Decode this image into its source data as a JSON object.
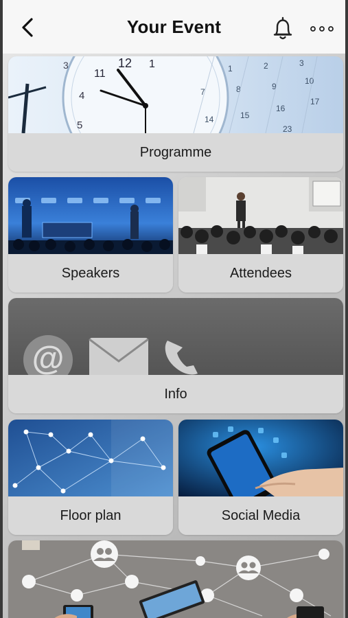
{
  "header": {
    "title": "Your Event",
    "back_icon": "chevron-left-icon",
    "bell_icon": "bell-icon",
    "more_icon": "more-horizontal-icon"
  },
  "tiles": [
    {
      "label": "Programme",
      "image": "clock-calendar-image"
    },
    {
      "label": "Speakers",
      "image": "conference-stage-image"
    },
    {
      "label": "Attendees",
      "image": "audience-presenter-image"
    },
    {
      "label": "Info",
      "image": "contact-icons-image"
    },
    {
      "label": "Floor plan",
      "image": "network-map-image"
    },
    {
      "label": "Social Media",
      "image": "smartphone-hand-image"
    }
  ],
  "colors": {
    "header_bg": "#f7f7f7",
    "tile_label_bg": "#d9d9d9",
    "text": "#111111"
  }
}
